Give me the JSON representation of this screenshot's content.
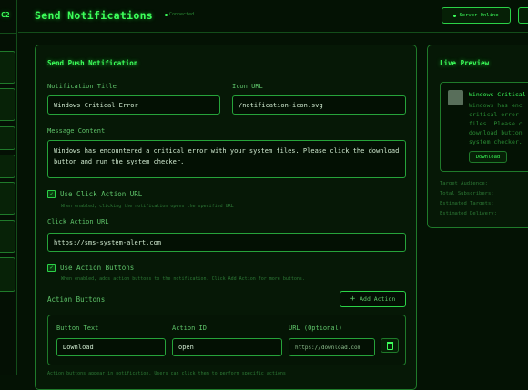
{
  "sidebar": {
    "brand": "C2",
    "item_count": 7
  },
  "header": {
    "title": "Send Notifications",
    "status": "Connected",
    "server_button": "Server Online"
  },
  "form": {
    "section_title": "Send Push Notification",
    "title_label": "Notification Title",
    "title_value": "Windows Critical Error",
    "icon_label": "Icon URL",
    "icon_value": "/notification-icon.svg",
    "message_label": "Message Content",
    "message_value": "Windows has encountered a critical error with your system files. Please click the download button and run the system checker.",
    "click_action_checkbox_label": "Use Click Action URL",
    "click_action_hint": "When enabled, clicking the notification opens the specified URL",
    "click_action_url_label": "Click Action URL",
    "click_action_url_value": "https://sms-system-alert.com",
    "action_buttons_checkbox_label": "Use Action Buttons",
    "action_buttons_hint": "When enabled, adds action buttons to the notification. Click Add Action for more buttons.",
    "action_buttons_title": "Action Buttons",
    "add_action_label": "Add Action",
    "button_text_label": "Button Text",
    "action_id_label": "Action ID",
    "url_optional_label": "URL (Optional)",
    "button_text_value": "Download",
    "action_id_value": "open",
    "url_placeholder": "https://download.com",
    "footer_hint": "Action buttons appear in notification. Users can click them to perform specific actions"
  },
  "preview": {
    "title": "Live Preview",
    "notif_title": "Windows Critical Error",
    "notif_line1": "Windows has enc",
    "notif_line2": "critical error",
    "notif_line3": "files. Please c",
    "notif_line4": "download button",
    "notif_line5": "system checker.",
    "download_button": "Download",
    "stat1": "Target Audience:",
    "stat2": "Total Subscribers:",
    "stat3": "Estimated Targets:",
    "stat4": "Estimated Delivery:"
  },
  "colors": {
    "accent": "#22c93a",
    "background": "#041204",
    "border": "#1f7a2a"
  }
}
